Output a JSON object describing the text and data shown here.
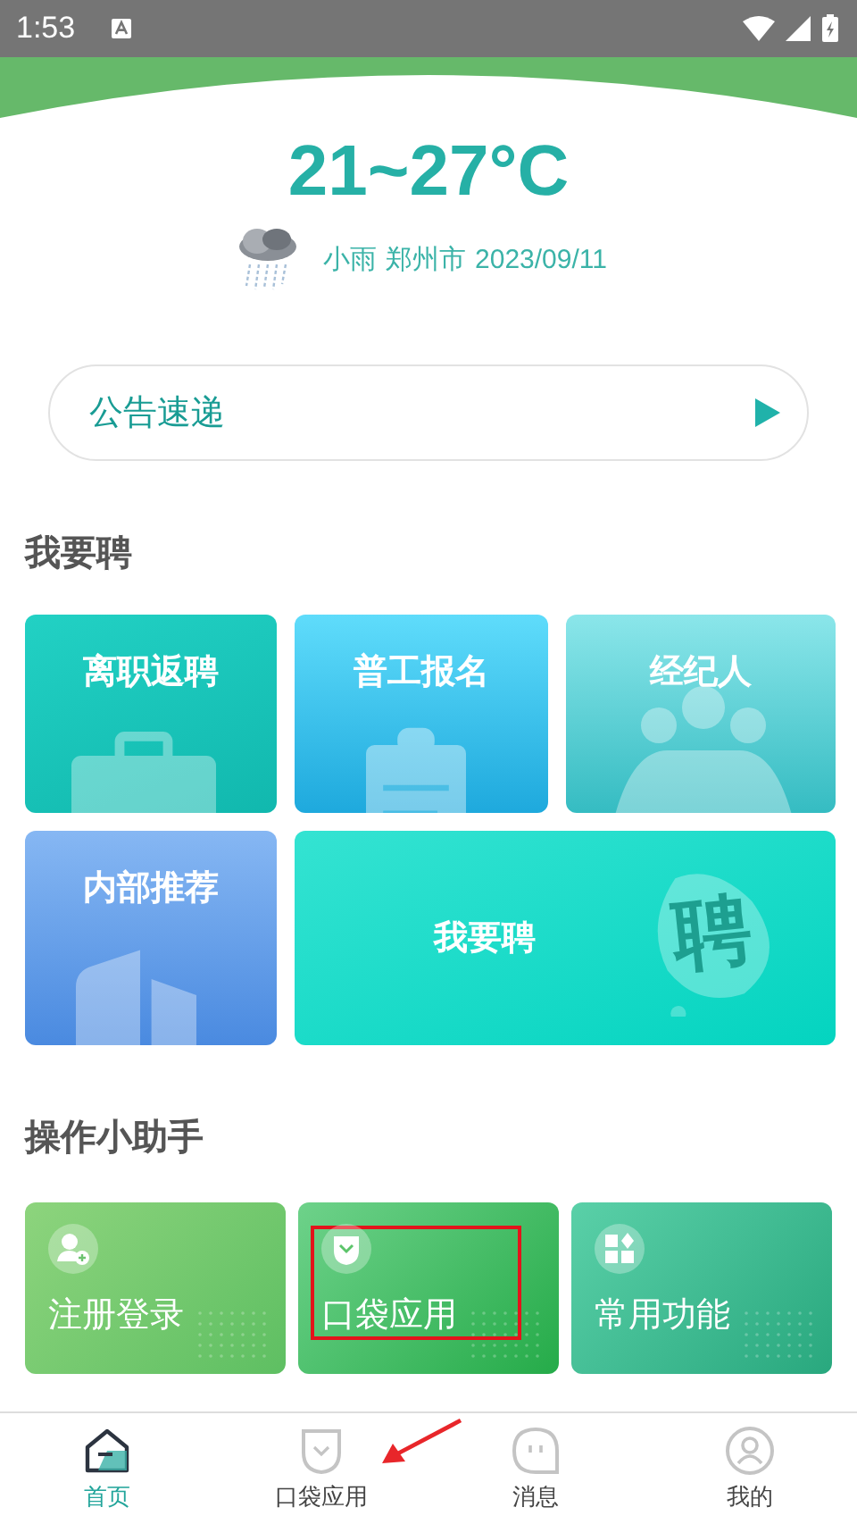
{
  "status_bar": {
    "time": "1:53"
  },
  "weather": {
    "temperature": "21~27°C",
    "condition": "小雨",
    "city": "郑州市",
    "date": "2023/09/11"
  },
  "notice": {
    "label": "公告速递"
  },
  "hiring": {
    "title": "我要聘",
    "tiles": [
      {
        "label": "离职返聘",
        "kind": "briefcase"
      },
      {
        "label": "普工报名",
        "kind": "clipboard"
      },
      {
        "label": "经纪人",
        "kind": "people"
      },
      {
        "label": "内部推荐",
        "kind": "buildings"
      },
      {
        "label": "我要聘",
        "kind": "bubble",
        "badge": "聘"
      }
    ]
  },
  "helper": {
    "title": "操作小助手",
    "cards": [
      {
        "label": "注册登录",
        "kind": "user-plus",
        "highlighted": false
      },
      {
        "label": "口袋应用",
        "kind": "pocket",
        "highlighted": true
      },
      {
        "label": "常用功能",
        "kind": "shapes",
        "highlighted": false
      }
    ]
  },
  "bottom_nav": [
    {
      "label": "首页",
      "kind": "home",
      "selected": true,
      "pointed": false
    },
    {
      "label": "口袋应用",
      "kind": "pocket",
      "selected": false,
      "pointed": true
    },
    {
      "label": "消息",
      "kind": "chat",
      "selected": false,
      "pointed": false
    },
    {
      "label": "我的",
      "kind": "profile",
      "selected": false,
      "pointed": false
    }
  ]
}
